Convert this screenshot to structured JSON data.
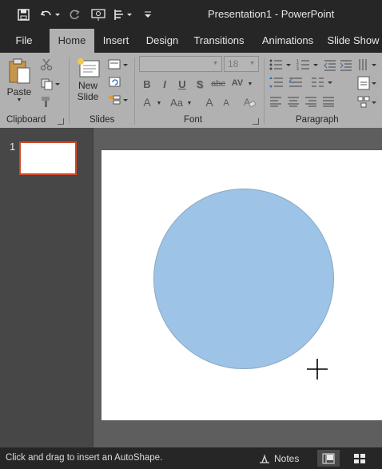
{
  "window": {
    "title": "Presentation1 - PowerPoint"
  },
  "quick_access": {
    "save_icon": "save-icon",
    "undo_icon": "undo-icon",
    "redo_icon": "redo-icon",
    "present_icon": "from-beginning-icon",
    "touch_icon": "touch-mode-icon",
    "customize_icon": "customize-qat-icon"
  },
  "tabs": [
    {
      "label": "File"
    },
    {
      "label": "Home",
      "active": true
    },
    {
      "label": "Insert"
    },
    {
      "label": "Design"
    },
    {
      "label": "Transitions"
    },
    {
      "label": "Animations"
    },
    {
      "label": "Slide Show"
    }
  ],
  "ribbon": {
    "clipboard": {
      "label": "Clipboard",
      "paste_label": "Paste"
    },
    "slides": {
      "label": "Slides",
      "new_slide_line1": "New",
      "new_slide_line2": "Slide"
    },
    "font": {
      "label": "Font",
      "font_name": "",
      "font_size": "18",
      "bold": "B",
      "italic": "I",
      "underline": "U",
      "shadow": "S",
      "strike": "abc",
      "spacing": "AV",
      "color": "A",
      "case": "Aa",
      "grow": "A",
      "shrink": "A"
    },
    "paragraph": {
      "label": "Paragraph"
    }
  },
  "thumbnails": [
    {
      "number": "1"
    }
  ],
  "status": {
    "message": "Click and drag to insert an AutoShape.",
    "notes_label": "Notes"
  },
  "colors": {
    "accent": "#d24726",
    "shape_fill": "#9dc3e6",
    "ribbon": "#b1b1b1",
    "titlebar": "#262626"
  }
}
